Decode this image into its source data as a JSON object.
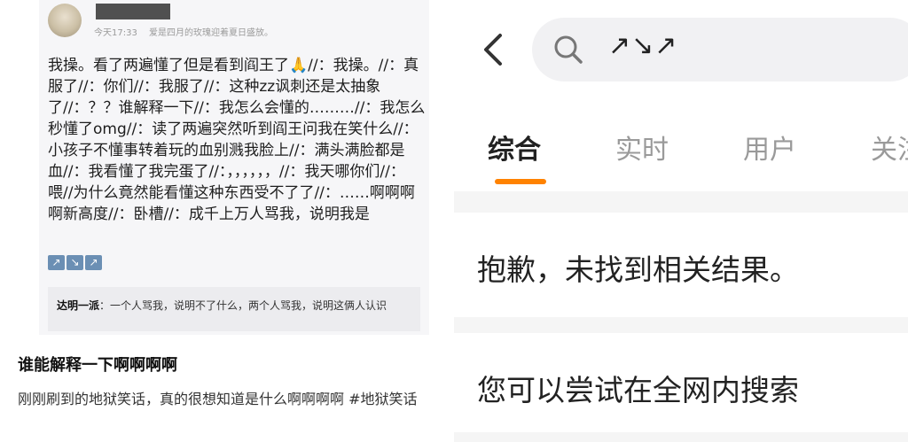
{
  "post": {
    "time": "今天17:33",
    "signature": "爱是四月的玫瑰迎着夏日盛放。",
    "body": "我操。看了两遍懂了但是看到阎王了🙏//：我操。//：真服了//：你们//：我服了//：这种zz讽刺还是太抽象了//：？？谁解释一下//：我怎么会懂的………//：我怎么秒懂了omg//：读了两遍突然听到阎王问我在笑什么//：小孩子不懂事转着玩的血别溅我脸上//：满头满脸都是血//：我看懂了我完蛋了//：，，，，，，//：我天哪你们//：喂//为什么竟然能看懂这种东西受不了了//：……啊啊啊啊新高度//：卧槽//：成千上万人骂我，说明我是",
    "arrow_icons": [
      "↗",
      "↘",
      "↗"
    ],
    "quote_author": "达明一派",
    "quote_text": "：一个人骂我，说明不了什么，两个人骂我，说明这俩人认识"
  },
  "left_caption": {
    "title": "谁能解释一下啊啊啊啊",
    "description": "刚刚刷到的地狱笑话，真的很想知道是什么啊啊啊啊",
    "hashtag": "#地狱笑话"
  },
  "search_page": {
    "query": "↗↘↗",
    "tabs": [
      {
        "label": "综合",
        "active": true
      },
      {
        "label": "实时",
        "active": false
      },
      {
        "label": "用户",
        "active": false
      },
      {
        "label": "关注",
        "active": false
      }
    ],
    "no_result_message": "抱歉，未找到相关结果。",
    "suggestion_message": "您可以尝试在全网内搜索",
    "accent_color": "#ff8200"
  },
  "icons": [
    "avatar",
    "back-icon",
    "search-icon",
    "arrow-emoji-icon"
  ]
}
